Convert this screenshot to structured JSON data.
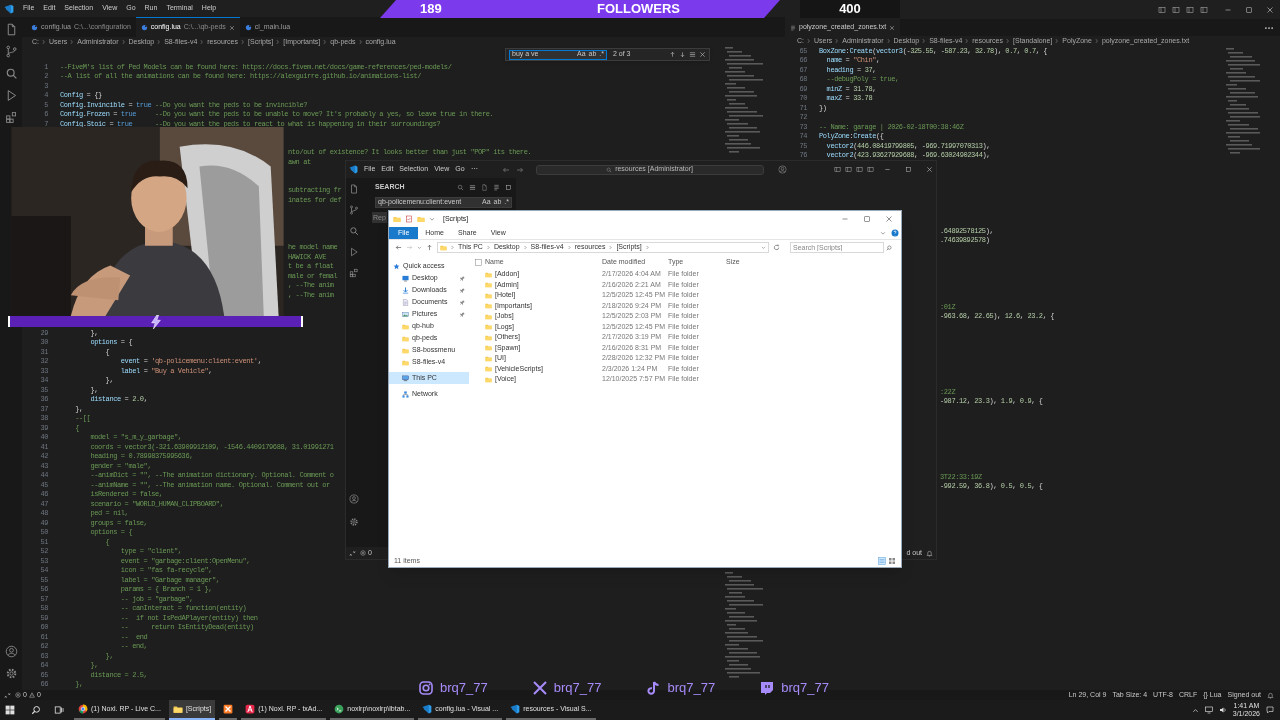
{
  "stream_overlay": {
    "followers_count": "189",
    "followers_label": "FOLLOWERS",
    "goal": "400",
    "socials": [
      {
        "kind": "instagram",
        "handle": "brq7_77"
      },
      {
        "kind": "x",
        "handle": "brq7_77"
      },
      {
        "kind": "tiktok",
        "handle": "brq7_77"
      },
      {
        "kind": "twitch",
        "handle": "brq7_77"
      }
    ]
  },
  "editor_left": {
    "menu": [
      "File",
      "Edit",
      "Selection",
      "View",
      "Go",
      "Run",
      "Terminal",
      "Help"
    ],
    "tabs": [
      {
        "label": "config.lua",
        "path": "C:\\...\\configuration",
        "selected": false
      },
      {
        "label": "config.lua",
        "path": "C:\\...\\qb-peds",
        "selected": true
      },
      {
        "label": "cl_main.lua",
        "selected": false
      }
    ],
    "breadcrumb": [
      "C:",
      "Users",
      "Administrator",
      "Desktop",
      "S8-files-v4",
      "resources",
      "[Scripts]",
      "[Importants]",
      "qb-peds",
      "config.lua"
    ],
    "find": {
      "value": "buy a ve",
      "options": [
        "Aa",
        "ab",
        ".*"
      ],
      "result": "2 of 3"
    },
    "lines_top": [
      {
        "n": "1",
        "text": "--FiveM's list of Ped Models can be found here: https://docs.fivem.net/docs/game-references/ped-models/",
        "kind": "comment"
      },
      {
        "n": "2",
        "text": "--A list of all the animations can be found here: https://alexguirre.github.io/animations-list/",
        "kind": "comment"
      },
      {
        "n": "3"
      },
      {
        "n": "4",
        "text": "Config = {}",
        "kind": "code"
      },
      {
        "n": "5",
        "text": "Config.Invincible = true --Do you want the peds to be invincible?",
        "kind": "code"
      },
      {
        "n": "6",
        "text": "Config.Frozen = true     --Do you want the peds to be unable to move? It's probably a yes, so leave true in there.",
        "kind": "code"
      },
      {
        "n": "7",
        "text": "Config.Stoic = true      --Do you want the peds to react to what is happening in their surroundings?",
        "kind": "code"
      }
    ],
    "fragments": [
      [
        {
          "text": "nto/out of existence? It looks better than just \"POP\" its there.",
          "kind": "comment"
        },
        {
          "text": "awn at",
          "kind": "comment"
        }
      ],
      [
        {
          "text": "subtracting fr",
          "kind": "comment"
        },
        {
          "text": "inates for def",
          "kind": "comment"
        }
      ],
      [
        {
          "text": "he model name",
          "kind": "comment"
        },
        {
          "text": "HAWICK AVE",
          "kind": "comment"
        },
        {
          "text": "t be a float",
          "kind": "comment"
        },
        {
          "text": "male or femal",
          "kind": "comment"
        },
        {
          "text": ", --The anim",
          "kind": "comment"
        },
        {
          "text": ", --The anim",
          "kind": "comment"
        }
      ]
    ],
    "lines_bottom": [
      {
        "n": "29",
        "text": "        },",
        "kind": "code"
      },
      {
        "n": "30",
        "text": "        options = {",
        "kind": "code"
      },
      {
        "n": "31",
        "text": "            {",
        "kind": "code"
      },
      {
        "n": "32",
        "text": "                event = 'qb-policemenu:client:event',",
        "kind": "code"
      },
      {
        "n": "33",
        "text": "                label = \"Buy a Vehicle\",",
        "kind": "code"
      },
      {
        "n": "34",
        "text": "            },",
        "kind": "code"
      },
      {
        "n": "35",
        "text": "        },",
        "kind": "code"
      },
      {
        "n": "36",
        "text": "        distance = 2.0,",
        "kind": "code"
      },
      {
        "n": "37",
        "text": "    },",
        "kind": "code"
      },
      {
        "n": "38",
        "text": "    --[[",
        "kind": "comment"
      },
      {
        "n": "39",
        "text": "    {",
        "kind": "comment"
      },
      {
        "n": "40",
        "text": "        model = \"s_m_y_garbage\",",
        "kind": "comment"
      },
      {
        "n": "41",
        "text": "        coords = vector3(-321.63909912109, -1546.4409179688, 31.01991271",
        "kind": "comment"
      },
      {
        "n": "42",
        "text": "        heading = 0.78998375995636,",
        "kind": "comment"
      },
      {
        "n": "43",
        "text": "        gender = \"male\",",
        "kind": "comment"
      },
      {
        "n": "44",
        "text": "        --animDict = \"\", --The animation dictionary. Optional. Comment o",
        "kind": "comment"
      },
      {
        "n": "45",
        "text": "        --animName = \"\", --The animation name. Optional. Comment out or",
        "kind": "comment"
      },
      {
        "n": "46",
        "text": "        isRendered = false,",
        "kind": "comment"
      },
      {
        "n": "47",
        "text": "        scenario = \"WORLD_HUMAN_CLIPBOARD\",",
        "kind": "comment"
      },
      {
        "n": "48",
        "text": "        ped = nil,",
        "kind": "comment"
      },
      {
        "n": "49",
        "text": "        groups = false,",
        "kind": "comment"
      },
      {
        "n": "50",
        "text": "        options = {",
        "kind": "comment"
      },
      {
        "n": "51",
        "text": "            {",
        "kind": "comment"
      },
      {
        "n": "52",
        "text": "                type = \"client\",",
        "kind": "comment"
      },
      {
        "n": "53",
        "text": "                event = \"garbage:client:OpenMenu\",",
        "kind": "comment"
      },
      {
        "n": "54",
        "text": "                icon = \"fas fa-recycle\",",
        "kind": "comment"
      },
      {
        "n": "55",
        "text": "                label = \"Garbage manager\",",
        "kind": "comment"
      },
      {
        "n": "56",
        "text": "                params = { Branch = 1 },",
        "kind": "comment"
      },
      {
        "n": "57",
        "text": "                -- job = \"garbage\",",
        "kind": "comment"
      },
      {
        "n": "58",
        "text": "                -- canInteract = function(entity)",
        "kind": "comment"
      },
      {
        "n": "59",
        "text": "                --  if not IsPedAPlayer(entity) then",
        "kind": "comment"
      },
      {
        "n": "60",
        "text": "                --      return IsEntityDead(entity)",
        "kind": "comment"
      },
      {
        "n": "61",
        "text": "                --  end",
        "kind": "comment"
      },
      {
        "n": "62",
        "text": "                -- end,",
        "kind": "comment"
      },
      {
        "n": "63",
        "text": "            },",
        "kind": "comment"
      },
      {
        "n": "64",
        "text": "        },",
        "kind": "comment"
      },
      {
        "n": "65",
        "text": "        distance = 2.5,",
        "kind": "comment"
      },
      {
        "n": "66",
        "text": "    },",
        "kind": "comment"
      }
    ],
    "status": {
      "errors": "0",
      "warnings": "0"
    }
  },
  "editor_right": {
    "tabs": [
      {
        "label": "polyzone_created_zones.txt",
        "selected": true
      }
    ],
    "breadcrumb": [
      "C:",
      "Users",
      "Administrator",
      "Desktop",
      "S8-files-v4",
      "resources",
      "[Standalone]",
      "PolyZone",
      "polyzone_created_zones.txt"
    ],
    "lines": [
      {
        "n": "65",
        "text": "BoxZone:Create(vector3(-325.55, -587.23, 32.78), 0.7, 0.7, {",
        "kind": "code"
      },
      {
        "n": "66",
        "text": "  name = \"Chin\",",
        "kind": "code"
      },
      {
        "n": "67",
        "text": "  heading = 37,",
        "kind": "code"
      },
      {
        "n": "68",
        "text": "  --debugPoly = true,",
        "kind": "code"
      },
      {
        "n": "69",
        "text": "  minZ = 31.78,",
        "kind": "code"
      },
      {
        "n": "70",
        "text": "  maxZ = 33.78",
        "kind": "code"
      },
      {
        "n": "71",
        "text": "})",
        "kind": "code"
      },
      {
        "n": "72"
      },
      {
        "n": "73",
        "text": "-- Name: garage | 2026-02-18T00:38:46Z",
        "kind": "comment"
      },
      {
        "n": "74",
        "text": "PolyZone:Create({",
        "kind": "code"
      },
      {
        "n": "75",
        "text": "  vector2(446.08419799805, -969.71997070313),",
        "kind": "code"
      },
      {
        "n": "76",
        "text": "  vector2(423.93627929688, -969.63024902344),",
        "kind": "code"
      }
    ],
    "fragments": [
      [
        {
          "text": ".64892578125),",
          "kind": "code"
        },
        {
          "text": ".74639892578)",
          "kind": "code"
        }
      ],
      [
        {
          "text": ":01Z",
          "kind": "comment"
        },
        {
          "text": "-963.68, 22.65), 12.6, 23.2, {",
          "kind": "code"
        }
      ],
      [
        {
          "text": ":22Z",
          "kind": "comment"
        },
        {
          "text": "-987.12, 23.3), 1.9, 0.9, {",
          "kind": "code"
        }
      ],
      [
        {
          "text": "3T22:33:19Z",
          "kind": "comment"
        },
        {
          "text": "-992.59, 36.8), 0.5, 0.5, {",
          "kind": "code"
        }
      ]
    ],
    "status_bar": [
      "Ln 29, Col 9",
      "Tab Size: 4",
      "UTF-8",
      "CRLF",
      "{} Lua",
      "Signed out"
    ]
  },
  "editor_middle": {
    "menu": [
      "File",
      "Edit",
      "Selection",
      "View",
      "Go",
      "⋯"
    ],
    "command_center": "resources [Administrator]",
    "search": {
      "title": "SEARCH",
      "query": "qb-policemenu:client:event",
      "options": [
        "Aa",
        "ab",
        ".*"
      ],
      "replace_placeholder": "Rep"
    },
    "status": {
      "errors": "0"
    },
    "status_right": "d out"
  },
  "explorer": {
    "title": "[Scripts]",
    "ribbon": [
      {
        "label": "File",
        "kind": "file",
        "selected": false
      },
      {
        "label": "Home",
        "kind": "tab",
        "selected": false
      },
      {
        "label": "Share",
        "kind": "tab",
        "selected": false
      },
      {
        "label": "View",
        "kind": "tab",
        "selected": false
      }
    ],
    "select_all_checked": false,
    "path": [
      "This PC",
      "Desktop",
      "S8-files-v4",
      "resources",
      "[Scripts]"
    ],
    "search_placeholder": "Search [Scripts]",
    "nav": [
      {
        "label": "Quick access",
        "kind": "quick_access",
        "pinned": false,
        "selected": false
      },
      {
        "label": "Desktop",
        "kind": "desktop",
        "pinned": true,
        "selected": false
      },
      {
        "label": "Downloads",
        "kind": "downloads",
        "pinned": true,
        "selected": false
      },
      {
        "label": "Documents",
        "kind": "documents",
        "pinned": true,
        "selected": false
      },
      {
        "label": "Pictures",
        "kind": "pictures",
        "pinned": true,
        "selected": false
      },
      {
        "label": "qb-hub",
        "kind": "folder",
        "pinned": false,
        "selected": false
      },
      {
        "label": "qb-peds",
        "kind": "folder",
        "pinned": false,
        "selected": false
      },
      {
        "label": "S8-bossmenu",
        "kind": "folder",
        "pinned": false,
        "selected": false
      },
      {
        "label": "S8-files-v4",
        "kind": "folder",
        "pinned": false,
        "selected": false
      },
      {
        "label": "This PC",
        "kind": "pc",
        "pinned": false,
        "selected": true
      },
      {
        "label": "Network",
        "kind": "network",
        "pinned": false,
        "selected": false
      }
    ],
    "columns": [
      "Name",
      "Date modified",
      "Type",
      "Size"
    ],
    "rows": [
      {
        "name": "[Addon]",
        "date": "2/17/2026 4:04 AM",
        "type": "File folder",
        "selected": false
      },
      {
        "name": "[Admin]",
        "date": "2/16/2026 2:21 AM",
        "type": "File folder",
        "selected": false
      },
      {
        "name": "[Hotel]",
        "date": "12/5/2025 12:45 PM",
        "type": "File folder",
        "selected": false
      },
      {
        "name": "[Importants]",
        "date": "2/18/2026 9:24 PM",
        "type": "File folder",
        "selected": false
      },
      {
        "name": "[Jobs]",
        "date": "12/5/2025 2:03 PM",
        "type": "File folder",
        "selected": false
      },
      {
        "name": "[Logs]",
        "date": "12/5/2025 12:45 PM",
        "type": "File folder",
        "selected": false
      },
      {
        "name": "[Others]",
        "date": "2/17/2026 3:19 PM",
        "type": "File folder",
        "selected": false
      },
      {
        "name": "[Spawn]",
        "date": "2/16/2026 8:31 PM",
        "type": "File folder",
        "selected": false
      },
      {
        "name": "[UI]",
        "date": "2/28/2026 12:32 PM",
        "type": "File folder",
        "selected": false
      },
      {
        "name": "[VehicleScripts]",
        "date": "2/3/2026 1:24 PM",
        "type": "File folder",
        "selected": false
      },
      {
        "name": "[Voice]",
        "date": "12/10/2025 7:57 PM",
        "type": "File folder",
        "selected": false
      }
    ],
    "status": "11 items"
  },
  "taskbar": {
    "apps": [
      {
        "kind": "chrome",
        "label": "(1) Noxl. RP - Live C...",
        "active": false
      },
      {
        "kind": "folder",
        "label": "[Scripts]",
        "active": true
      },
      {
        "kind": "xampp",
        "active": false
      },
      {
        "kind": "txadmin",
        "label": "(1) Noxl. RP - txAd...",
        "active": false
      },
      {
        "kind": "terminal",
        "label": "noxlrp\\noxlrp\\lbtab...",
        "active": false
      },
      {
        "kind": "vscode",
        "label": "config.lua - Visual ...",
        "active": false
      },
      {
        "kind": "vscode",
        "label": "resources - Visual S...",
        "active": false
      }
    ],
    "time": "1:41 AM",
    "date": "3/1/2026"
  }
}
